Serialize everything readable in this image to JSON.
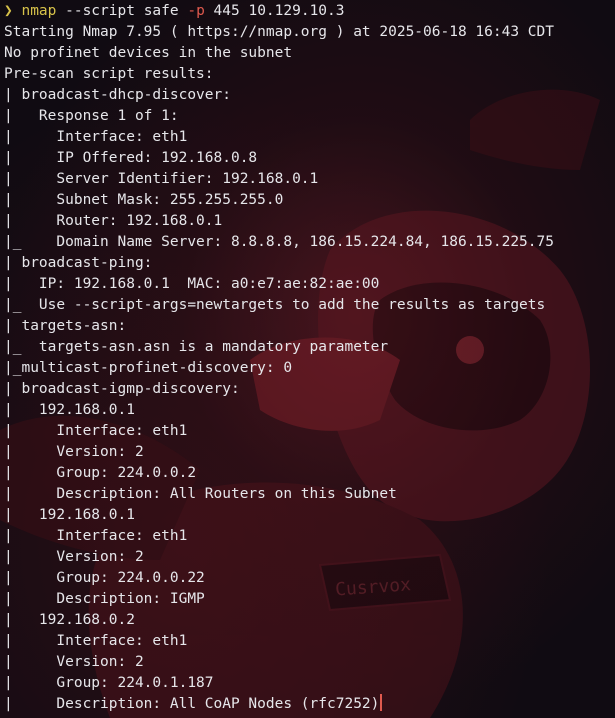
{
  "prompt": {
    "arrow": "❯",
    "command": "nmap",
    "args_before": " --script safe ",
    "flag": "-p",
    "args_after": " 445 10.129.10.3"
  },
  "output": [
    "Starting Nmap 7.95 ( https://nmap.org ) at 2025-06-18 16:43 CDT",
    "No profinet devices in the subnet",
    "Pre-scan script results:",
    "| broadcast-dhcp-discover:",
    "|   Response 1 of 1:",
    "|     Interface: eth1",
    "|     IP Offered: 192.168.0.8",
    "|     Server Identifier: 192.168.0.1",
    "|     Subnet Mask: 255.255.255.0",
    "|     Router: 192.168.0.1",
    "|_    Domain Name Server: 8.8.8.8, 186.15.224.84, 186.15.225.75",
    "| broadcast-ping:",
    "|   IP: 192.168.0.1  MAC: a0:e7:ae:82:ae:00",
    "|_  Use --script-args=newtargets to add the results as targets",
    "| targets-asn:",
    "|_  targets-asn.asn is a mandatory parameter",
    "|_multicast-profinet-discovery: 0",
    "| broadcast-igmp-discovery:",
    "|   192.168.0.1",
    "|     Interface: eth1",
    "|     Version: 2",
    "|     Group: 224.0.0.2",
    "|     Description: All Routers on this Subnet",
    "|   192.168.0.1",
    "|     Interface: eth1",
    "|     Version: 2",
    "|     Group: 224.0.0.22",
    "|     Description: IGMP",
    "|   192.168.0.2",
    "|     Interface: eth1",
    "|     Version: 2",
    "|     Group: 224.0.1.187",
    "|     Description: All CoAP Nodes (rfc7252)"
  ],
  "wallpaper_text": "Cusrvox",
  "colors": {
    "background": "#100b12",
    "text": "#e6e6ea",
    "command": "#d7c24a",
    "flag": "#e05a4e",
    "cursor": "#e05a4e",
    "wallpaper_red": "#6e1c26"
  }
}
